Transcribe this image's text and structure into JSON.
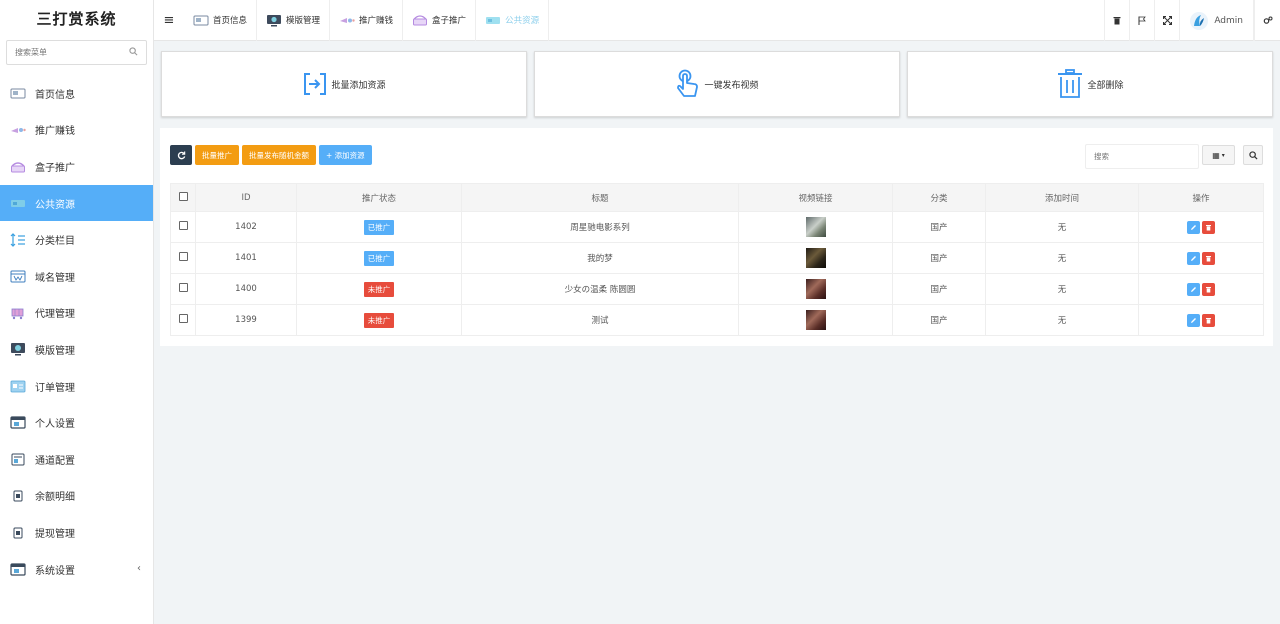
{
  "app": {
    "title": "三打赏系统"
  },
  "sidebar": {
    "search_placeholder": "搜索菜单",
    "items": [
      {
        "label": "首页信息"
      },
      {
        "label": "推广赚钱"
      },
      {
        "label": "盒子推广"
      },
      {
        "label": "公共资源",
        "active": true
      },
      {
        "label": "分类栏目"
      },
      {
        "label": "域名管理"
      },
      {
        "label": "代理管理"
      },
      {
        "label": "模版管理"
      },
      {
        "label": "订单管理"
      },
      {
        "label": "个人设置"
      },
      {
        "label": "通道配置"
      },
      {
        "label": "余额明细"
      },
      {
        "label": "提现管理"
      },
      {
        "label": "系统设置"
      }
    ]
  },
  "topbar": {
    "tabs": [
      {
        "label": "首页信息"
      },
      {
        "label": "模版管理"
      },
      {
        "label": "推广赚钱"
      },
      {
        "label": "盒子推广"
      },
      {
        "label": "公共资源",
        "active": true
      }
    ],
    "user": "Admin"
  },
  "actions": {
    "batch_add": "批量添加资源",
    "publish_video": "一键发布视频",
    "delete_all": "全部删除"
  },
  "toolbar": {
    "batch_promote": "批量推广",
    "batch_random_amount": "批量发布随机金额",
    "add_resource": "+ 添加资源",
    "search_placeholder": "搜索"
  },
  "table": {
    "headers": [
      "ID",
      "推广状态",
      "标题",
      "视频链接",
      "分类",
      "添加时间",
      "操作"
    ],
    "rows": [
      {
        "id": "1402",
        "status": "已推广",
        "promoted": true,
        "title": "周星驰电影系列",
        "category": "国产",
        "added": "无"
      },
      {
        "id": "1401",
        "status": "已推广",
        "promoted": true,
        "title": "我的梦",
        "category": "国产",
        "added": "无"
      },
      {
        "id": "1400",
        "status": "未推广",
        "promoted": false,
        "title": "少女の温柔 陈圆圆",
        "category": "国产",
        "added": "无"
      },
      {
        "id": "1399",
        "status": "未推广",
        "promoted": false,
        "title": "测试",
        "category": "国产",
        "added": "无"
      }
    ]
  },
  "colors": {
    "accent": "#55aef8",
    "promoted": "#55aef8",
    "not_promoted": "#e74c3c",
    "orange": "#f39c12",
    "dark": "#2c3e50"
  }
}
